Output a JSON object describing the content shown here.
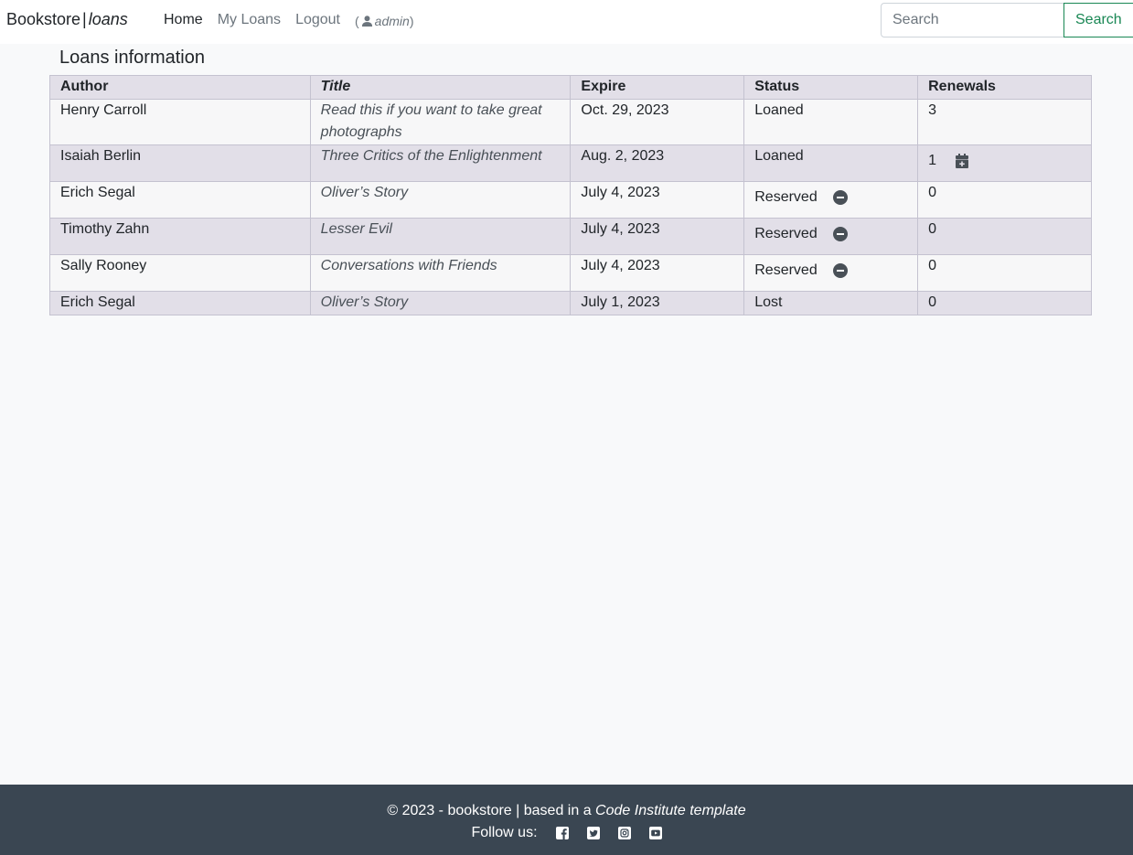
{
  "nav": {
    "brand_main": "Bookstore",
    "brand_sep": "|",
    "brand_sub": "loans",
    "links": [
      "Home",
      "My Loans",
      "Logout"
    ],
    "user": "admin",
    "search_placeholder": "Search",
    "search_button": "Search"
  },
  "main": {
    "heading": "Loans information",
    "columns": [
      "Author",
      "Title",
      "Expire",
      "Status",
      "Renewals"
    ],
    "rows": [
      {
        "author": "Henry Carroll",
        "title": "Read this if you want to take great photographs",
        "expire": "Oct. 29, 2023",
        "status": "Loaned",
        "renewals": "3"
      },
      {
        "author": "Isaiah Berlin",
        "title": "Three Critics of the Enlightenment",
        "expire": "Aug. 2, 2023",
        "status": "Loaned",
        "renewals": "1"
      },
      {
        "author": "Erich Segal",
        "title": "Oliver’s Story",
        "expire": "July 4, 2023",
        "status": "Reserved",
        "renewals": "0"
      },
      {
        "author": "Timothy Zahn",
        "title": "Lesser Evil",
        "expire": "July 4, 2023",
        "status": "Reserved",
        "renewals": "0"
      },
      {
        "author": "Sally Rooney",
        "title": "Conversations with Friends",
        "expire": "July 4, 2023",
        "status": "Reserved",
        "renewals": "0"
      },
      {
        "author": "Erich Segal",
        "title": "Oliver’s Story",
        "expire": "July 1, 2023",
        "status": "Lost",
        "renewals": "0"
      }
    ]
  },
  "footer": {
    "copyright": "© 2023 - bookstore | based in a",
    "template": "Code Institute template",
    "follow": "Follow us:"
  },
  "icons": {
    "user": "user-icon",
    "renew": "calendar-plus-icon",
    "cancel": "minus-circle-icon",
    "social": [
      "facebook-icon",
      "twitter-icon",
      "instagram-icon",
      "youtube-icon"
    ]
  },
  "colors": {
    "accent": "#198754",
    "footer_bg": "#3a4652",
    "row_alt": "#e2dfe8"
  }
}
